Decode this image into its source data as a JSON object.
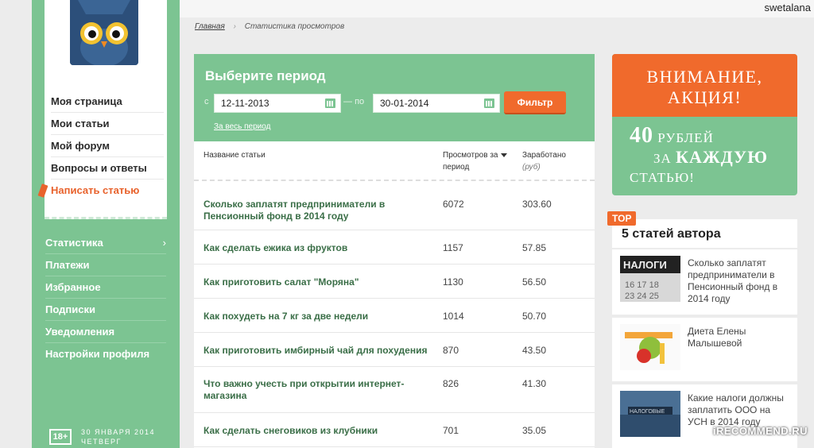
{
  "user": {
    "name": "swetalana"
  },
  "breadcrumb": {
    "home": "Главная",
    "current": "Статистика просмотров"
  },
  "profile_menu": [
    {
      "label": "Моя страница"
    },
    {
      "label": "Мои статьи"
    },
    {
      "label": "Мой форум"
    },
    {
      "label": "Вопросы и ответы"
    },
    {
      "label": "Написать статью"
    }
  ],
  "nav": [
    {
      "label": "Статистика",
      "chevron": "›"
    },
    {
      "label": "Платежи"
    },
    {
      "label": "Избранное"
    },
    {
      "label": "Подписки"
    },
    {
      "label": "Уведомления"
    },
    {
      "label": "Настройки профиля"
    }
  ],
  "footer": {
    "age": "18+",
    "date": "30 января 2014",
    "weekday": "четверг"
  },
  "filter": {
    "title": "Выберите период",
    "from_label": "с",
    "from_value": "12-11-2013",
    "to_label": "по",
    "to_value": "30-01-2014",
    "button": "Фильтр",
    "all_period": "За весь период"
  },
  "table": {
    "columns": {
      "title": "Название статьи",
      "views_l1": "Просмотров за",
      "views_l2": "период",
      "earned_l1": "Заработано",
      "earned_l2": "(руб)"
    },
    "rows": [
      {
        "title": "Сколько заплатят предприниматели в Пенсионный фонд в 2014 году",
        "views": "6072",
        "earned": "303.60"
      },
      {
        "title": "Как сделать ежика из фруктов",
        "views": "1157",
        "earned": "57.85"
      },
      {
        "title": "Как приготовить салат \"Моряна\"",
        "views": "1130",
        "earned": "56.50"
      },
      {
        "title": "Как похудеть на 7 кг за две недели",
        "views": "1014",
        "earned": "50.70"
      },
      {
        "title": "Как приготовить имбирный чай для похудения",
        "views": "870",
        "earned": "43.50"
      },
      {
        "title": "Что важно учесть при открытии интернет-магазина",
        "views": "826",
        "earned": "41.30"
      },
      {
        "title": "Как сделать снеговиков из клубники",
        "views": "701",
        "earned": "35.05"
      }
    ]
  },
  "promo": {
    "line1": "Внимание,",
    "line2": "акция!",
    "amount": "40",
    "rub": "рублей",
    "za": "за",
    "each": "каждую",
    "article": "статью!"
  },
  "top_articles": {
    "badge": "TOP",
    "title": "5 статей автора",
    "items": [
      {
        "title": "Сколько заплатят предприниматели в Пенсионный фонд в 2014 году"
      },
      {
        "title": "Диета Елены Малышевой"
      },
      {
        "title": "Какие налоги должны заплатить ООО на УСН в 2014 году"
      }
    ]
  },
  "watermark": "iRECOMMEND.RU",
  "colors": {
    "green": "#7cc492",
    "orange": "#f06a2c",
    "link_green": "#3a6e47"
  }
}
